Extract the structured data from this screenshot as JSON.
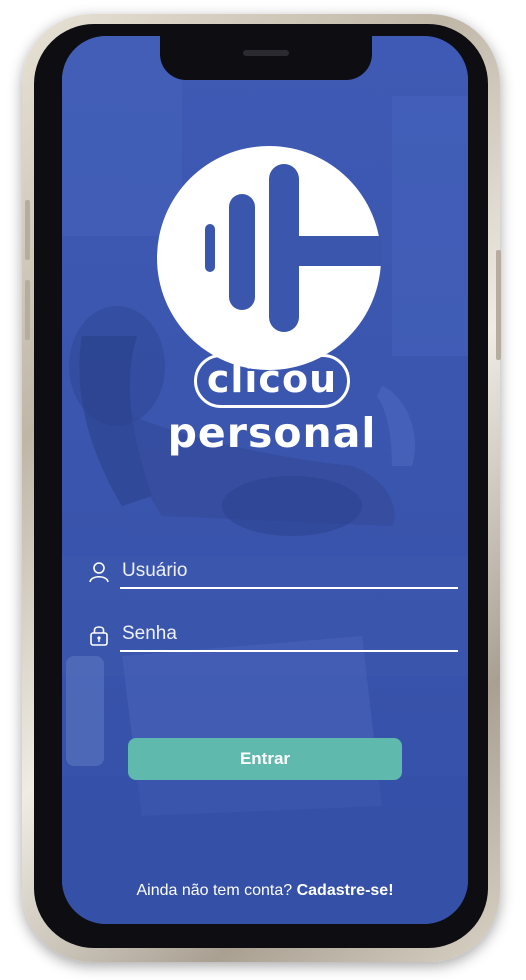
{
  "app": {
    "brand_line1": "clicou",
    "brand_line2": "personal",
    "logo_icon": "clicou-c-logo-icon"
  },
  "login": {
    "username_placeholder": "Usuário",
    "password_placeholder": "Senha",
    "username_icon": "user-icon",
    "password_icon": "lock-icon",
    "submit_label": "Entrar"
  },
  "footer": {
    "signup_prompt": "Ainda não tem conta?",
    "signup_link": "Cadastre-se!"
  },
  "colors": {
    "background_overlay": "#3b56ad",
    "accent_button": "#5fb9ad",
    "text": "#ffffff"
  }
}
